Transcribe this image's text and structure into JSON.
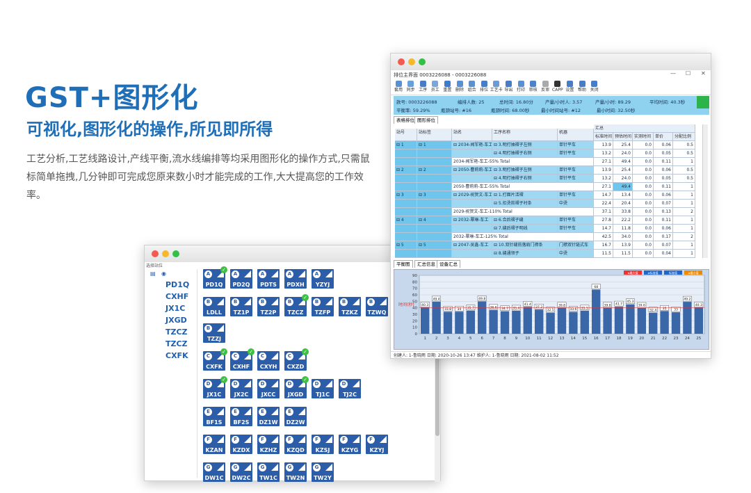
{
  "hero": {
    "title": "GST+图形化",
    "subtitle": "可视化,图形化的操作,所见即所得",
    "description": "工艺分析,工艺线路设计,产线平衡,流水线编排等均采用图形化的操作方式,只需鼠标简单拖拽,几分钟即可完成您原来数小时才能完成的工作,大大提高您的工作效率。"
  },
  "back_window": {
    "crumb": "选择站位",
    "tree_codes": [
      "PD1Q",
      "CXHF",
      "JX1C",
      "JXGD",
      "TZCZ",
      "TZCZ",
      "CXFK"
    ],
    "tile_rows": [
      [
        {
          "l": "A",
          "c": "PD1Q",
          "k": true
        },
        {
          "l": "A",
          "c": "PD2Q",
          "k": false
        },
        {
          "l": "A",
          "c": "PDTS",
          "k": false
        },
        {
          "l": "A",
          "c": "PDXH",
          "k": false
        },
        {
          "l": "A",
          "c": "YZYJ",
          "k": false
        }
      ],
      [
        {
          "l": "B",
          "c": "LDLL",
          "k": false
        },
        {
          "l": "B",
          "c": "TZ1P",
          "k": false
        },
        {
          "l": "B",
          "c": "TZ2P",
          "k": false
        },
        {
          "l": "B",
          "c": "TZCZ",
          "k": true
        },
        {
          "l": "B",
          "c": "TZFP",
          "k": false
        },
        {
          "l": "B",
          "c": "TZKZ",
          "k": false
        },
        {
          "l": "B",
          "c": "TZWQ",
          "k": false
        }
      ],
      [
        {
          "l": "B",
          "c": "TZZJ",
          "k": false
        }
      ],
      [
        {
          "l": "C",
          "c": "CXFK",
          "k": true
        },
        {
          "l": "C",
          "c": "CXHF",
          "k": true
        },
        {
          "l": "C",
          "c": "CXYH",
          "k": false
        },
        {
          "l": "C",
          "c": "CXZD",
          "k": true
        }
      ],
      [
        {
          "l": "D",
          "c": "JX1C",
          "k": true
        },
        {
          "l": "D",
          "c": "JX2C",
          "k": false
        },
        {
          "l": "D",
          "c": "JXCC",
          "k": false
        },
        {
          "l": "D",
          "c": "JXGD",
          "k": true
        },
        {
          "l": "D",
          "c": "TJ1C",
          "k": false
        },
        {
          "l": "D",
          "c": "TJ2C",
          "k": false
        }
      ],
      [
        {
          "l": "E",
          "c": "BF1S",
          "k": false
        },
        {
          "l": "E",
          "c": "BF2S",
          "k": false
        },
        {
          "l": "E",
          "c": "DZ1W",
          "k": false
        },
        {
          "l": "E",
          "c": "DZ2W",
          "k": false
        }
      ],
      [
        {
          "l": "F",
          "c": "KZAN",
          "k": false
        },
        {
          "l": "F",
          "c": "KZDX",
          "k": false
        },
        {
          "l": "F",
          "c": "KZHZ",
          "k": false
        },
        {
          "l": "F",
          "c": "KZQD",
          "k": false
        },
        {
          "l": "F",
          "c": "KZSJ",
          "k": false
        },
        {
          "l": "F",
          "c": "KZYG",
          "k": false
        },
        {
          "l": "F",
          "c": "KZYJ",
          "k": false
        }
      ],
      [
        {
          "l": "G",
          "c": "DW1C",
          "k": false
        },
        {
          "l": "G",
          "c": "DW2C",
          "k": false
        },
        {
          "l": "G",
          "c": "TW1C",
          "k": false
        },
        {
          "l": "G",
          "c": "TW2N",
          "k": false
        },
        {
          "l": "G",
          "c": "TW2Y",
          "k": false
        }
      ]
    ]
  },
  "front_window": {
    "title": "排位主界面 0003226088 - 0003226088",
    "toolbar": [
      "套用",
      "同步",
      "工序",
      "员工",
      "重置",
      "删除",
      "组合",
      "排位",
      "工艺卡",
      "导出",
      "打印",
      "审核",
      "反审",
      "CAPP",
      "设置",
      "帮助",
      "关闭"
    ],
    "info": {
      "order": "款号: 0003226088",
      "workers": "编排人数: 25",
      "total": "总时间: 16.80分",
      "per_hour": "产量/小时人: 3.57",
      "per_hour2": "产量/小时: 89.29",
      "avg": "平均时间: 40.3秒",
      "balance": "平衡率: 59.29%",
      "bottleneck": "瓶颈站号: #16",
      "btime": "瓶颈时间: 68.00秒",
      "min_station": "最小时间站号: #12",
      "min_time": "最小时间: 32.50秒"
    },
    "tabs": [
      "表格排位",
      "图形排位"
    ],
    "columns": [
      "站号",
      "站标签",
      "站名",
      "工序名称",
      "机器",
      "标准时间",
      "预估时间",
      "实测时间",
      "单价",
      "分配比例"
    ],
    "group_header": "汇总",
    "rows": [
      [
        "1",
        "1",
        "2034-闻军艳-车工",
        "3.明打抽褶子左侧",
        "单针平车",
        "13.9",
        "25.4",
        "0.0",
        "0.06",
        "0.5"
      ],
      [
        "",
        "",
        "",
        "4.明打抽褶子右侧",
        "单针平车",
        "13.2",
        "24.0",
        "0.0",
        "0.05",
        "0.5"
      ],
      [
        "",
        "",
        "2034-闻军艳-车工-55% Total",
        "",
        "",
        "27.1",
        "49.4",
        "0.0",
        "0.11",
        "1"
      ],
      [
        "2",
        "2",
        "2050-曹莉莉-车工",
        "3.明打抽褶子左侧",
        "单针平车",
        "13.9",
        "25.4",
        "0.0",
        "0.06",
        "0.5"
      ],
      [
        "",
        "",
        "",
        "4.明打抽褶子右侧",
        "单针平车",
        "13.2",
        "24.0",
        "0.0",
        "0.05",
        "0.5"
      ],
      [
        "",
        "",
        "2050-曹莉莉-车工-55% Total",
        "",
        "",
        "27.1",
        "49.4",
        "0.0",
        "0.11",
        "1"
      ],
      [
        "3",
        "3",
        "2029-祝贺文-车工",
        "1.打面片活褶",
        "单针平车",
        "14.7",
        "13.4",
        "0.0",
        "0.06",
        "1"
      ],
      [
        "",
        "",
        "",
        "5.扣烫前褶子衬条",
        "中烫",
        "22.4",
        "20.4",
        "0.0",
        "0.07",
        "1"
      ],
      [
        "",
        "",
        "2029-祝贺文-车工-110% Total",
        "",
        "",
        "37.1",
        "33.8",
        "0.0",
        "0.13",
        "2"
      ],
      [
        "4",
        "4",
        "2032-覃琳-车工",
        "6.合后褶子缝",
        "单针平车",
        "27.8",
        "22.2",
        "0.0",
        "0.11",
        "1"
      ],
      [
        "",
        "",
        "",
        "7.缝后褶子明线",
        "单针平车",
        "14.7",
        "11.8",
        "0.0",
        "0.06",
        "1"
      ],
      [
        "",
        "",
        "2032-覃琳-车工-125% Total",
        "",
        "",
        "42.5",
        "34.0",
        "0.0",
        "0.17",
        "2"
      ],
      [
        "5",
        "5",
        "2047-吴鑫-车工",
        "10.双针缝前落肩门襟条",
        "门襟双针链式车",
        "16.7",
        "13.9",
        "0.0",
        "0.07",
        "1"
      ],
      [
        "",
        "",
        "",
        "8.缝通领子",
        "中烫",
        "11.5",
        "11.5",
        "0.0",
        "0.04",
        "1"
      ]
    ],
    "bottom_tabs": [
      "平衡图",
      "汇总信息",
      "设备汇总"
    ],
    "chart_legend": [
      "≤最大值",
      "≥标准值",
      "标准值",
      "≥最小值"
    ],
    "ylabel": "时间(秒)",
    "status": "创建人: 1-鲁晓雨 日期: 2020-10-26 13:47   维护人: 1-鲁晓雨 日期: 2021-08-02 11:52"
  },
  "chart_data": {
    "type": "bar",
    "categories": [
      "1",
      "2",
      "3",
      "4",
      "5",
      "6",
      "7",
      "8",
      "9",
      "10",
      "11",
      "12",
      "13",
      "14",
      "15",
      "16",
      "17",
      "18",
      "19",
      "20",
      "21",
      "22",
      "23",
      "24",
      "25"
    ],
    "values": [
      40.3,
      49.4,
      33.8,
      34,
      35.7,
      49.8,
      36.6,
      34.7,
      35.4,
      41.4,
      37.2,
      32.5,
      39.8,
      33.6,
      35.5,
      68,
      39.8,
      41.7,
      45.3,
      39.6,
      32.4,
      35,
      33,
      49.2,
      40.3
    ],
    "ylim": [
      0,
      90
    ],
    "yticks": [
      0,
      10,
      20,
      30,
      40,
      50,
      60,
      70,
      80,
      90
    ],
    "bar_color": "#3a67a8"
  }
}
